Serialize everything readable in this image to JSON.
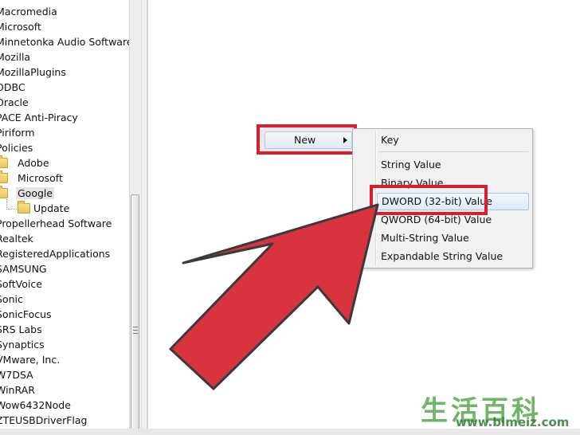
{
  "tree": {
    "items": [
      {
        "label": "Macromedia",
        "indent": 0,
        "folder": false
      },
      {
        "label": "Microsoft",
        "indent": 0,
        "folder": false
      },
      {
        "label": "Minnetonka Audio Software",
        "indent": 0,
        "folder": false
      },
      {
        "label": "Mozilla",
        "indent": 0,
        "folder": false
      },
      {
        "label": "MozillaPlugins",
        "indent": 0,
        "folder": false
      },
      {
        "label": "ODBC",
        "indent": 0,
        "folder": false
      },
      {
        "label": "Oracle",
        "indent": 0,
        "folder": false
      },
      {
        "label": "PACE Anti-Piracy",
        "indent": 0,
        "folder": false
      },
      {
        "label": "Piriform",
        "indent": 0,
        "folder": false
      },
      {
        "label": "Policies",
        "indent": 0,
        "folder": false
      },
      {
        "label": "Adobe",
        "indent": 1,
        "folder": true
      },
      {
        "label": "Microsoft",
        "indent": 1,
        "folder": true
      },
      {
        "label": "Google",
        "indent": 1,
        "folder": true,
        "selected": true
      },
      {
        "label": "Update",
        "indent": 2,
        "folder": true
      },
      {
        "label": "Propellerhead Software",
        "indent": 0,
        "folder": false
      },
      {
        "label": "Realtek",
        "indent": 0,
        "folder": false
      },
      {
        "label": "RegisteredApplications",
        "indent": 0,
        "folder": false
      },
      {
        "label": "SAMSUNG",
        "indent": 0,
        "folder": false
      },
      {
        "label": "SoftVoice",
        "indent": 0,
        "folder": false
      },
      {
        "label": "Sonic",
        "indent": 0,
        "folder": false
      },
      {
        "label": "SonicFocus",
        "indent": 0,
        "folder": false
      },
      {
        "label": "SRS Labs",
        "indent": 0,
        "folder": false
      },
      {
        "label": "Synaptics",
        "indent": 0,
        "folder": false
      },
      {
        "label": "VMware, Inc.",
        "indent": 0,
        "folder": false
      },
      {
        "label": "W7DSA",
        "indent": 0,
        "folder": false
      },
      {
        "label": "WinRAR",
        "indent": 0,
        "folder": false
      },
      {
        "label": "Wow6432Node",
        "indent": 0,
        "folder": false
      },
      {
        "label": "ZTEUSBDriverFlag",
        "indent": 0,
        "folder": false
      }
    ]
  },
  "context_menu": {
    "new_label": "New",
    "submenu": [
      {
        "label": "Key"
      },
      {
        "label": "String Value"
      },
      {
        "label": "Binary Value"
      },
      {
        "label": "DWORD (32-bit) Value",
        "highlighted": true
      },
      {
        "label": "QWORD (64-bit) Value"
      },
      {
        "label": "Multi-String Value"
      },
      {
        "label": "Expandable String Value"
      }
    ]
  },
  "watermark": {
    "text": "生活百科",
    "url": "www.bimeiz.com"
  },
  "colors": {
    "highlight_box": "#d7202e",
    "arrow_fill": "#d93340",
    "arrow_stroke": "#3a3a3a"
  }
}
